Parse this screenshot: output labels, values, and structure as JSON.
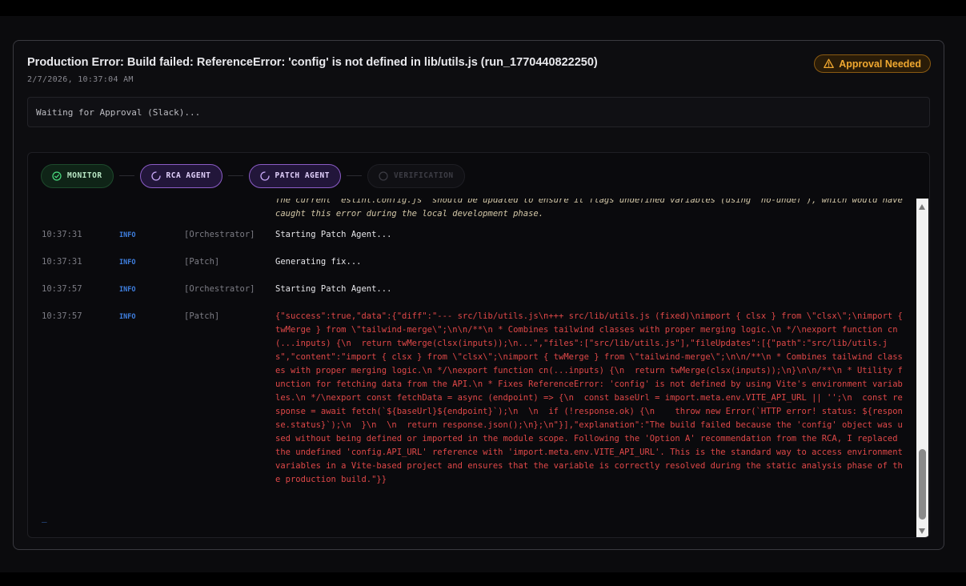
{
  "header": {
    "title": "Production Error: Build failed: ReferenceError: 'config' is not defined in lib/utils.js (run_1770440822250)",
    "timestamp": "2/7/2026, 10:37:04 AM",
    "badge": "Approval Needed"
  },
  "status": {
    "text": "Waiting for Approval (Slack)..."
  },
  "pipeline": {
    "steps": [
      {
        "label": "MONITOR",
        "state": "done"
      },
      {
        "label": "RCA AGENT",
        "state": "active"
      },
      {
        "label": "PATCH AGENT",
        "state": "active"
      },
      {
        "label": "VERIFICATION",
        "state": "pending"
      }
    ]
  },
  "log": {
    "previous_text": "The current `eslint.config.js` should be updated to ensure it flags undefined variables (using `no-undef`), which would have caught this error during the local development phase.",
    "entries": [
      {
        "time": "10:37:31",
        "level": "INFO",
        "source": "[Orchestrator]",
        "message": "Starting Patch Agent..."
      },
      {
        "time": "10:37:31",
        "level": "INFO",
        "source": "[Patch]",
        "message": "Generating fix..."
      },
      {
        "time": "10:37:57",
        "level": "INFO",
        "source": "[Orchestrator]",
        "message": "Starting Patch Agent..."
      },
      {
        "time": "10:37:57",
        "level": "INFO",
        "source": "[Patch]",
        "message": "{\"success\":true,\"data\":{\"diff\":\"--- src/lib/utils.js\\n+++ src/lib/utils.js (fixed)\\nimport { clsx } from \\\"clsx\\\";\\nimport { twMerge } from \\\"tailwind-merge\\\";\\n\\n/**\\n * Combines tailwind classes with proper merging logic.\\n */\\nexport function cn(...inputs) {\\n  return twMerge(clsx(inputs));\\n...\",\"files\":[\"src/lib/utils.js\"],\"fileUpdates\":[{\"path\":\"src/lib/utils.js\",\"content\":\"import { clsx } from \\\"clsx\\\";\\nimport { twMerge } from \\\"tailwind-merge\\\";\\n\\n/**\\n * Combines tailwind classes with proper merging logic.\\n */\\nexport function cn(...inputs) {\\n  return twMerge(clsx(inputs));\\n}\\n\\n/**\\n * Utility function for fetching data from the API.\\n * Fixes ReferenceError: 'config' is not defined by using Vite's environment variables.\\n */\\nexport const fetchData = async (endpoint) => {\\n  const baseUrl = import.meta.env.VITE_API_URL || '';\\n  const response = await fetch(`${baseUrl}${endpoint}`);\\n  \\n  if (!response.ok) {\\n    throw new Error(`HTTP error! status: ${response.status}`);\\n  }\\n  \\n  return response.json();\\n};\\n\"}],\"explanation\":\"The build failed because the 'config' object was used without being defined or imported in the module scope. Following the 'Option A' recommendation from the RCA, I replaced the undefined 'config.API_URL' reference with 'import.meta.env.VITE_API_URL'. This is the standard way to access environment variables in a Vite-based project and ensures that the variable is correctly resolved during the static analysis phase of the production build.\"}}",
        "error": true
      }
    ],
    "cursor": "_"
  },
  "colors": {
    "approval": "#f0a830",
    "info": "#3f7fe0",
    "error": "#e04848",
    "active_step": "#8b5cc6",
    "done_step": "#1d4a2c"
  }
}
